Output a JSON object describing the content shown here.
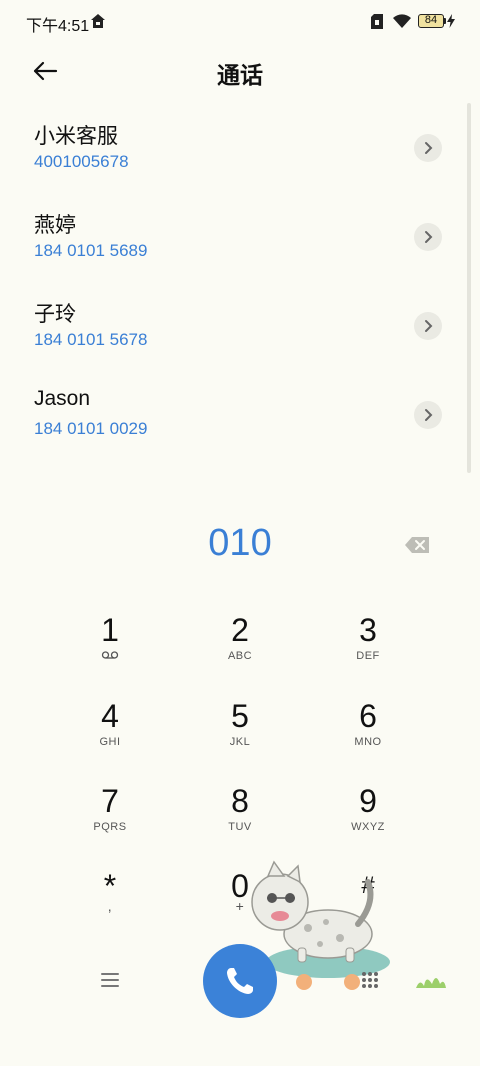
{
  "status_bar": {
    "time": "下午4:51",
    "battery": "84"
  },
  "header": {
    "title": "通话"
  },
  "contacts": [
    {
      "name": "小米客服",
      "number": "4001005678"
    },
    {
      "name": "燕婷",
      "number": "184 0101 5689"
    },
    {
      "name": "子玲",
      "number": "184 0101 5678"
    },
    {
      "name": "Jason",
      "number": "184 0101 0029"
    }
  ],
  "dial": {
    "number": "010"
  },
  "keys": [
    {
      "digit": "1",
      "letters": ""
    },
    {
      "digit": "2",
      "letters": "ABC"
    },
    {
      "digit": "3",
      "letters": "DEF"
    },
    {
      "digit": "4",
      "letters": "GHI"
    },
    {
      "digit": "5",
      "letters": "JKL"
    },
    {
      "digit": "6",
      "letters": "MNO"
    },
    {
      "digit": "7",
      "letters": "PQRS"
    },
    {
      "digit": "8",
      "letters": "TUV"
    },
    {
      "digit": "9",
      "letters": "WXYZ"
    },
    {
      "digit": "*",
      "letters": ","
    },
    {
      "digit": "0",
      "letters": "+"
    },
    {
      "digit": "#",
      "letters": ""
    }
  ],
  "icons": {
    "back": "arrow-left-icon",
    "backspace": "backspace-icon",
    "voicemail": "voicemail-icon",
    "menu": "menu-icon",
    "call": "phone-icon",
    "dialpad": "dialpad-icon"
  },
  "colors": {
    "accent": "#3a7fd5",
    "call_button": "#3b82d8",
    "background": "#fbfbf4"
  }
}
